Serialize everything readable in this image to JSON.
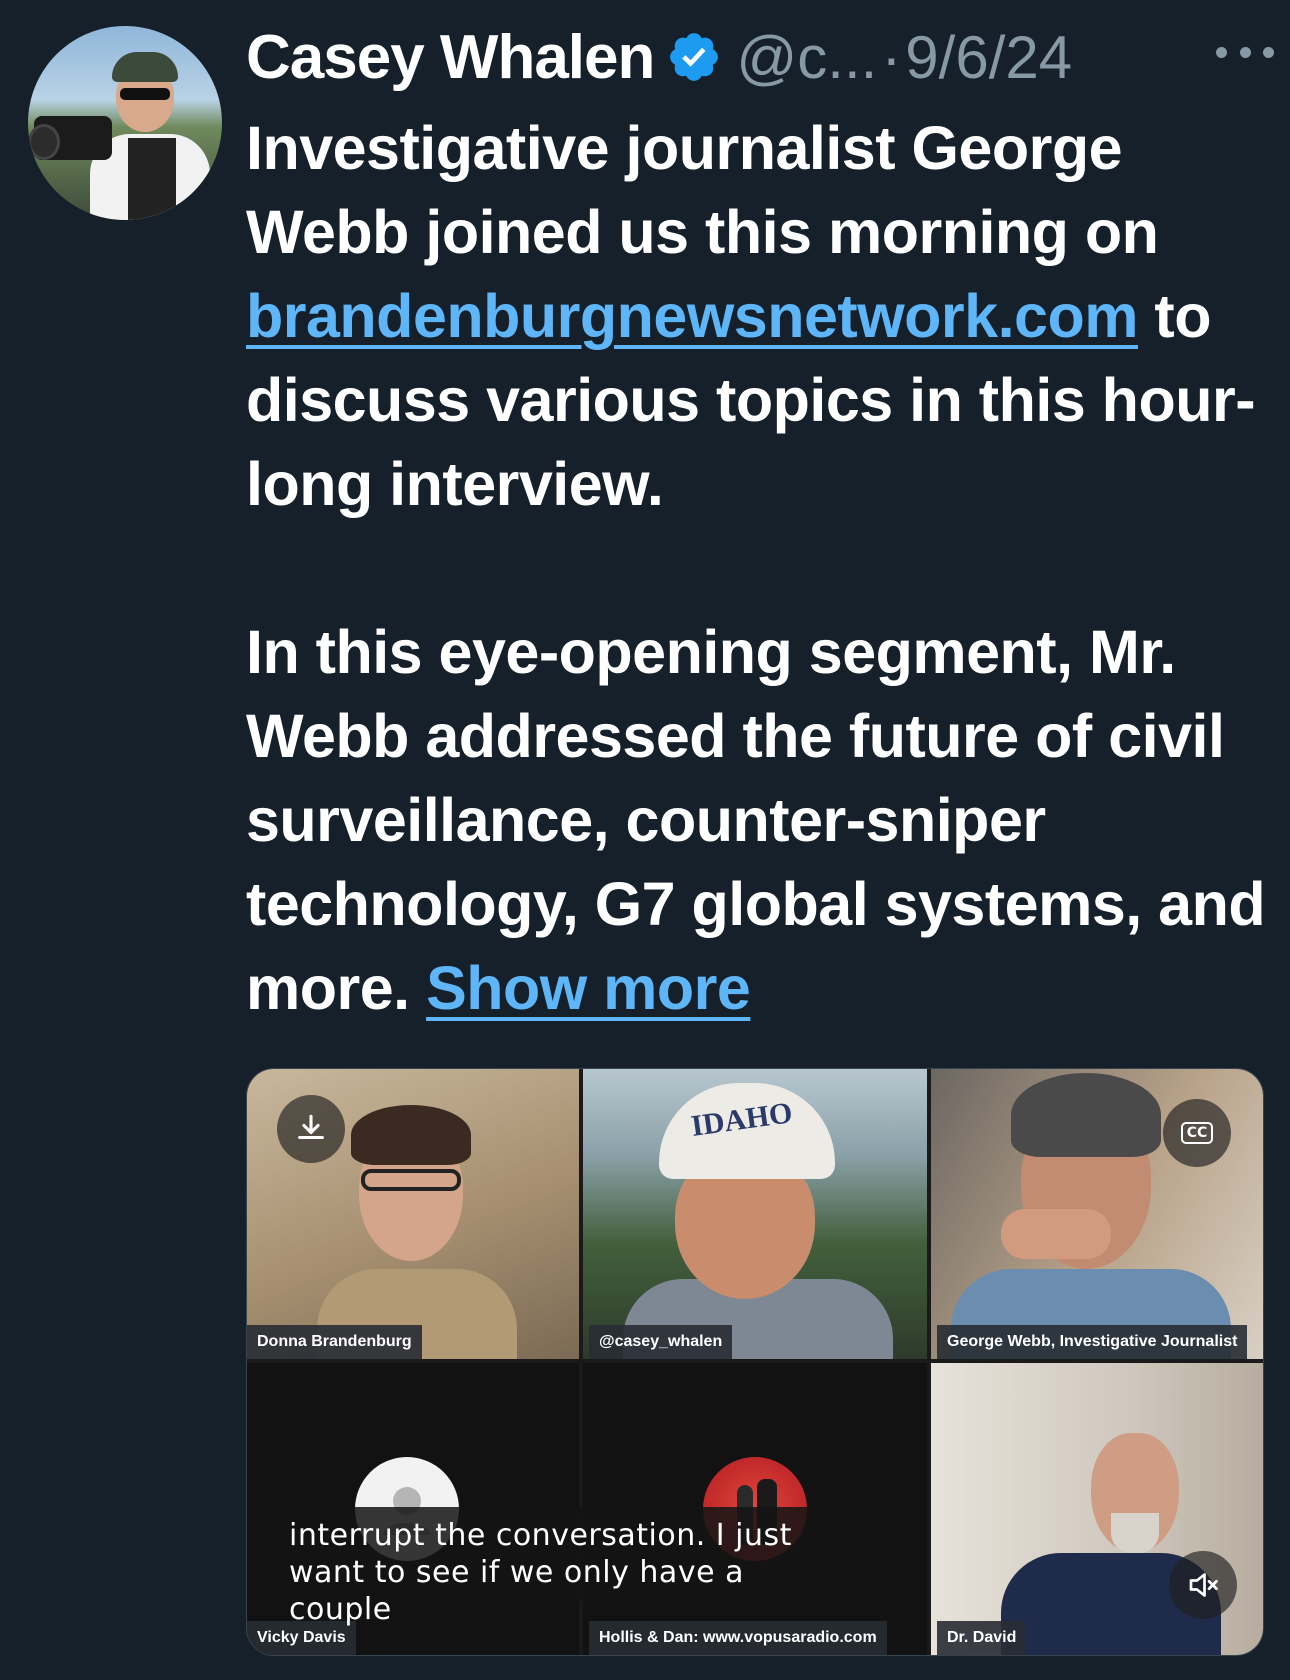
{
  "tweet": {
    "author_name": "Casey Whalen",
    "handle": "@c...",
    "separator": "·",
    "date": "9/6/24",
    "paragraph1_before_link": "Investigative journalist George Webb joined us this morning on ",
    "link_text": "brandenburgnewsnetwork.com",
    "paragraph1_after_link": " to discuss various topics in this hour-long interview.",
    "paragraph2": "In this eye-opening segment, Mr. Webb addressed the future of civil surveillance, counter-sniper technology, G7 global systems, and more. ",
    "show_more": "Show more"
  },
  "video": {
    "participants": [
      "Donna Brandenburg",
      "@casey_whalen",
      "George Webb, Investigative Journalist",
      "Vicky Davis",
      "Hollis & Dan: www.vopusaradio.com",
      "Dr. David"
    ],
    "cap_text": "IDAHO",
    "caption_line1": "interrupt the conversation. I just",
    "caption_line2": "want to see if we only have a couple",
    "cc_label": "CC"
  },
  "icons": {
    "verified": "verified-badge-icon",
    "more": "more-options-icon",
    "download": "download-icon",
    "cc": "closed-captions-icon",
    "mute": "mute-icon",
    "placeholder_avatar": "user-placeholder-icon"
  },
  "colors": {
    "background": "#15202b",
    "link": "#5eb5f7",
    "secondary_text": "#8899a6",
    "verified": "#1d9bf0"
  }
}
